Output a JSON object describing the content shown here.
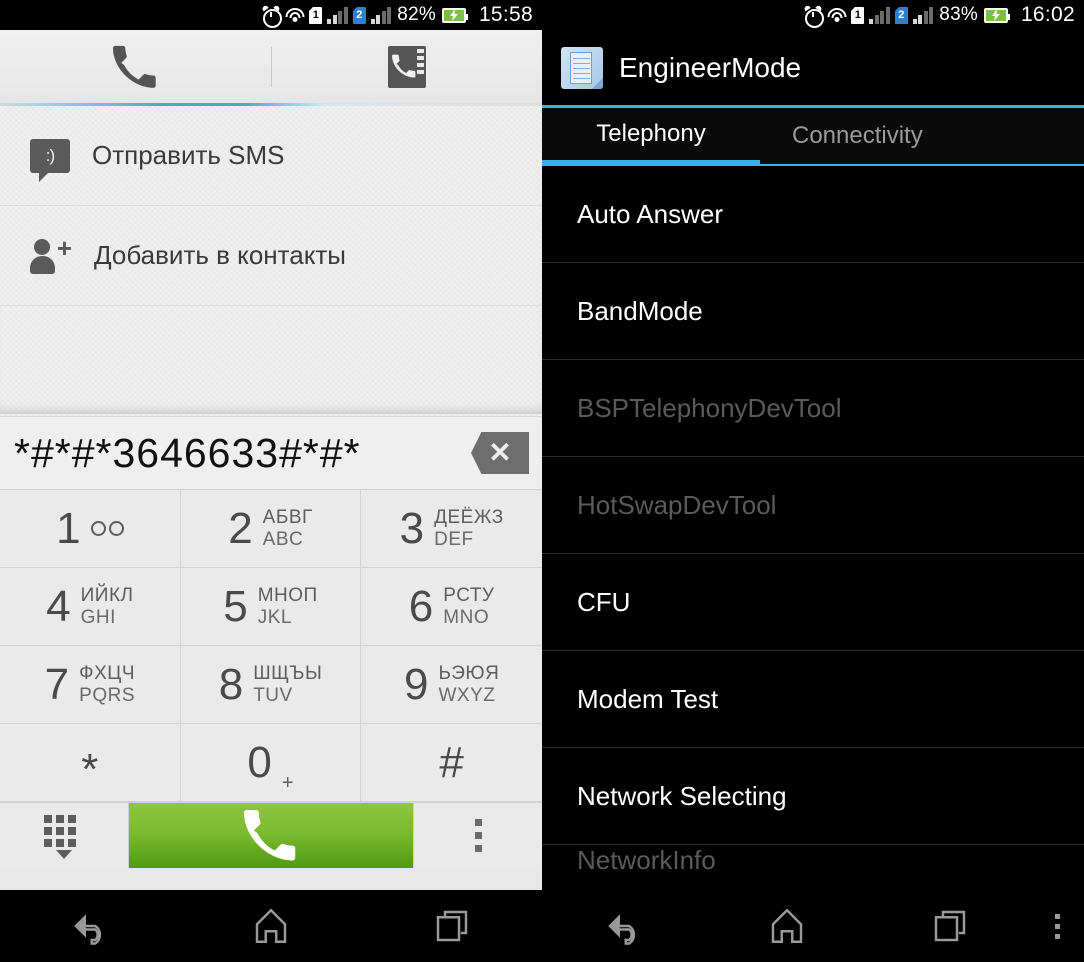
{
  "left": {
    "statusbar": {
      "icons": [
        "alarm-icon",
        "wifi-icon",
        "sim1-icon",
        "signal1-icon",
        "sim2-icon",
        "signal2-icon",
        "battery-icon"
      ],
      "sim1_label": "1",
      "sim2_label": "2",
      "battery_percent": "82%",
      "time": "15:58"
    },
    "tabs": [
      {
        "name": "dialer-tab",
        "icon": "phone-icon"
      },
      {
        "name": "contacts-tab",
        "icon": "contact-book-icon"
      }
    ],
    "context_list": [
      {
        "icon": "sms-icon",
        "label": "Отправить SMS"
      },
      {
        "icon": "add-contact-icon",
        "label": "Добавить в контакты"
      }
    ],
    "dial_input": {
      "value": "*#*#*3646633#*#*",
      "backspace_glyph": "✕"
    },
    "keypad": [
      {
        "digit": "1",
        "ru": "",
        "en": "",
        "extra": "voicemail-icon"
      },
      {
        "digit": "2",
        "ru": "АБВГ",
        "en": "ABC",
        "extra": ""
      },
      {
        "digit": "3",
        "ru": "ДЕЁЖЗ",
        "en": "DEF",
        "extra": ""
      },
      {
        "digit": "4",
        "ru": "ИЙКЛ",
        "en": "GHI",
        "extra": ""
      },
      {
        "digit": "5",
        "ru": "МНОП",
        "en": "JKL",
        "extra": ""
      },
      {
        "digit": "6",
        "ru": "РСТУ",
        "en": "MNO",
        "extra": ""
      },
      {
        "digit": "7",
        "ru": "ФХЦЧ",
        "en": "PQRS",
        "extra": ""
      },
      {
        "digit": "8",
        "ru": "ШЩЪЫ",
        "en": "TUV",
        "extra": ""
      },
      {
        "digit": "9",
        "ru": "ЬЭЮЯ",
        "en": "WXYZ",
        "extra": ""
      },
      {
        "digit": "*",
        "ru": "",
        "en": "",
        "extra": ""
      },
      {
        "digit": "0",
        "ru": "",
        "en": "",
        "extra": "+"
      },
      {
        "digit": "#",
        "ru": "",
        "en": "",
        "extra": ""
      }
    ],
    "action_bar": {
      "keypad_toggle": "keypad-toggle-icon",
      "call_button": "call-icon",
      "overflow": "overflow-menu-icon",
      "call_button_color": "#7cbb31"
    }
  },
  "right": {
    "statusbar": {
      "sim1_label": "1",
      "sim2_label": "2",
      "battery_percent": "83%",
      "time": "16:02"
    },
    "app": {
      "icon": "engineer-mode-icon",
      "title": "EngineerMode",
      "accent_color": "#33b5e5"
    },
    "tabs": [
      {
        "label": "Telephony",
        "active": true
      },
      {
        "label": "Connectivity",
        "active": false
      }
    ],
    "items": [
      {
        "label": "Auto Answer",
        "enabled": true
      },
      {
        "label": "BandMode",
        "enabled": true
      },
      {
        "label": "BSPTelephonyDevTool",
        "enabled": false
      },
      {
        "label": "HotSwapDevTool",
        "enabled": false
      },
      {
        "label": "CFU",
        "enabled": true
      },
      {
        "label": "Modem Test",
        "enabled": true
      },
      {
        "label": "Network Selecting",
        "enabled": true
      },
      {
        "label": "NetworkInfo",
        "enabled": false
      }
    ]
  },
  "navbar": {
    "back": "back-icon",
    "home": "home-icon",
    "recents": "recents-icon",
    "overflow": "overflow-menu-icon"
  }
}
